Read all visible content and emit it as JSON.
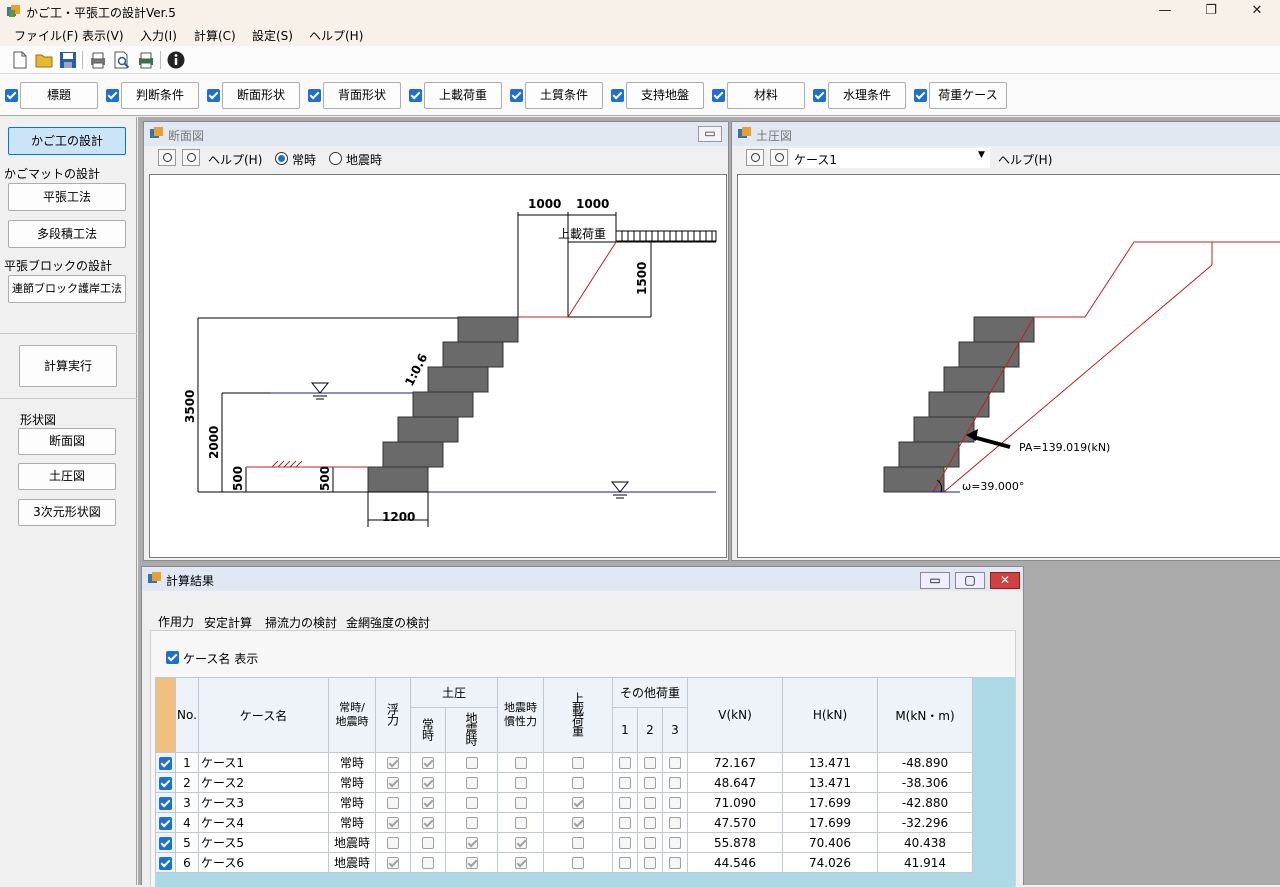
{
  "app": {
    "title": "かご工・平張工の設計Ver.5"
  },
  "menu": [
    "ファイル(F)",
    "表示(V)",
    "入力(I)",
    "計算(C)",
    "設定(S)",
    "ヘルプ(H)"
  ],
  "input_buttons": [
    "標題",
    "判断条件",
    "断面形状",
    "背面形状",
    "上載荷重",
    "土質条件",
    "支持地盤",
    "材料",
    "水理条件",
    "荷重ケース"
  ],
  "left": {
    "kago_btn": "かご工の設計",
    "mat_label": "かごマットの設計",
    "hira_btn": "平張工法",
    "tadan_btn": "多段積工法",
    "block_label": "平張ブロックの設計",
    "renketsu_btn": "連節ブロック護岸工法",
    "calc_btn": "計算実行",
    "shape_label": "形状図",
    "danmen_btn": "断面図",
    "doatsu_btn": "土圧図",
    "threed_btn": "3次元形状図"
  },
  "section_win": {
    "title": "断面図",
    "help": "ヘルプ(H)",
    "radio_normal": "常時",
    "radio_quake": "地震時",
    "dims": {
      "top1": "1000",
      "top2": "1000",
      "load": "上載荷重",
      "h1500": "1500",
      "slope": "1:0.6",
      "h3500": "3500",
      "h2000": "2000",
      "h500a": "500",
      "h500b": "500",
      "w1200": "1200"
    }
  },
  "pressure_win": {
    "title": "土圧図",
    "case_select": "ケース1",
    "help": "ヘルプ(H)",
    "pa": "PA=139.019(kN)",
    "omega": "ω=39.000°"
  },
  "result_win": {
    "title": "計算結果",
    "tabs": [
      "作用力",
      "安定計算",
      "掃流力の検討",
      "金網強度の検討"
    ],
    "show_case_name": "ケース名 表示",
    "headers": {
      "no": "No.",
      "case": "ケース名",
      "normal_quake": "常時/地震時",
      "buoy": "浮力",
      "earth": "土圧",
      "earth_normal": "常時",
      "earth_quake": "地震時",
      "quake_inertia": "地震時慣性力",
      "surcharge": "上載荷重",
      "other": "その他荷重",
      "o1": "1",
      "o2": "2",
      "o3": "3",
      "v": "V(kN)",
      "h": "H(kN)",
      "m": "M(kN・m)"
    },
    "rows": [
      {
        "no": "1",
        "case": "ケース1",
        "mode": "常時",
        "buoy": true,
        "en": true,
        "eq": false,
        "qi": false,
        "sur": false,
        "v": "72.167",
        "h": "13.471",
        "m": "-48.890"
      },
      {
        "no": "2",
        "case": "ケース2",
        "mode": "常時",
        "buoy": true,
        "en": true,
        "eq": false,
        "qi": false,
        "sur": false,
        "v": "48.647",
        "h": "13.471",
        "m": "-38.306"
      },
      {
        "no": "3",
        "case": "ケース3",
        "mode": "常時",
        "buoy": false,
        "en": true,
        "eq": false,
        "qi": false,
        "sur": true,
        "v": "71.090",
        "h": "17.699",
        "m": "-42.880"
      },
      {
        "no": "4",
        "case": "ケース4",
        "mode": "常時",
        "buoy": true,
        "en": true,
        "eq": false,
        "qi": false,
        "sur": true,
        "v": "47.570",
        "h": "17.699",
        "m": "-32.296"
      },
      {
        "no": "5",
        "case": "ケース5",
        "mode": "地震時",
        "buoy": false,
        "en": false,
        "eq": true,
        "qi": true,
        "sur": false,
        "v": "55.878",
        "h": "70.406",
        "m": "40.438"
      },
      {
        "no": "6",
        "case": "ケース6",
        "mode": "地震時",
        "buoy": true,
        "en": false,
        "eq": true,
        "qi": true,
        "sur": false,
        "v": "44.546",
        "h": "74.026",
        "m": "41.914"
      }
    ]
  }
}
